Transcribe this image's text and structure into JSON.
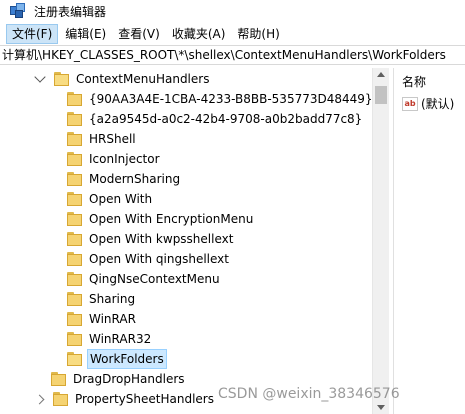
{
  "window": {
    "title": "注册表编辑器"
  },
  "menu": [
    {
      "label": "文件(F)",
      "active": true
    },
    {
      "label": "编辑(E)",
      "active": false
    },
    {
      "label": "查看(V)",
      "active": false
    },
    {
      "label": "收藏夹(A)",
      "active": false
    },
    {
      "label": "帮助(H)",
      "active": false
    }
  ],
  "address": "计算机\\HKEY_CLASSES_ROOT\\*\\shellex\\ContextMenuHandlers\\WorkFolders",
  "tree": {
    "parent": {
      "label": "ContextMenuHandlers",
      "expanded": true
    },
    "children": [
      "{90AA3A4E-1CBA-4233-B8BB-535773D48449}",
      "{a2a9545d-a0c2-42b4-9708-a0b2badd77c8}",
      "HRShell",
      "IconInjector",
      "ModernSharing",
      "Open With",
      "Open With EncryptionMenu",
      "Open With kwpsshellext",
      "Open With qingshellext",
      "QingNseContextMenu",
      "Sharing",
      "WinRAR",
      "WinRAR32",
      "WorkFolders"
    ],
    "selected": "WorkFolders",
    "siblings": [
      {
        "label": "DragDropHandlers",
        "expandable": false
      },
      {
        "label": "PropertySheetHandlers",
        "expandable": true
      }
    ]
  },
  "values_pane": {
    "column_header": "名称",
    "rows": [
      {
        "icon": "string-value-icon",
        "icon_text": "ab",
        "name": "(默认)"
      }
    ]
  },
  "watermark": "CSDN @weixin_38346576"
}
